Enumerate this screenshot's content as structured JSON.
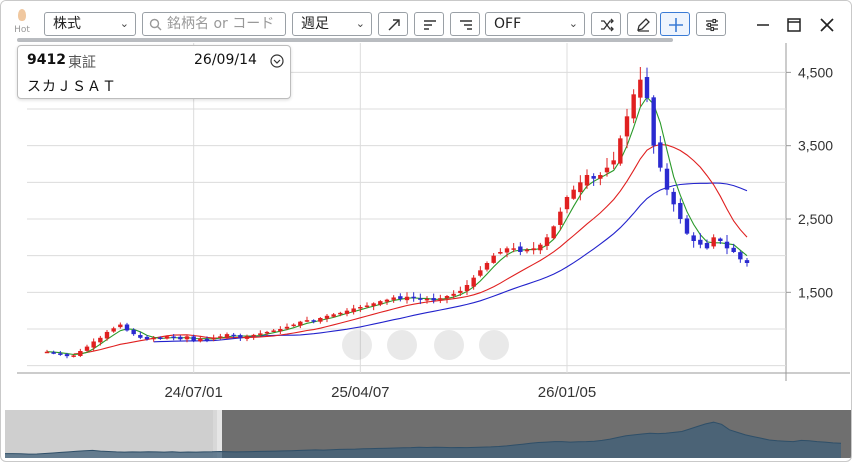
{
  "toolbar": {
    "hot_label": "Hot",
    "market_select": "株式",
    "search_placeholder": "銘柄名 or コード",
    "period_select": "週足",
    "indicator_select": "OFF",
    "icons": [
      "trend-line-icon",
      "align-left-icon",
      "align-right-icon",
      "shuffle-icon",
      "pencil-icon",
      "crosshair-plus-icon",
      "settings-sliders-icon"
    ],
    "window_icons": [
      "minimize-icon",
      "maximize-icon",
      "close-icon"
    ]
  },
  "info_box": {
    "code": "9412",
    "exchange": "東証",
    "date": "26/09/14",
    "name": "スカＪＳＡＴ"
  },
  "chart_data": {
    "type": "candlestick",
    "y_axis": {
      "ticks": [
        "4,500",
        "3,500",
        "2,500",
        "1,500"
      ],
      "range": [
        400,
        4900
      ]
    },
    "x_axis": {
      "ticks": [
        "24/07/01",
        "25/04/07",
        "26/01/05"
      ]
    },
    "close_series": [
      690,
      680,
      660,
      630,
      640,
      700,
      760,
      830,
      880,
      960,
      1010,
      1060,
      980,
      930,
      880,
      860,
      880,
      870,
      900,
      880,
      860,
      900,
      840,
      870,
      860,
      880,
      900,
      930,
      910,
      880,
      900,
      920,
      940,
      960,
      980,
      1000,
      1030,
      1060,
      1100,
      1120,
      1100,
      1150,
      1180,
      1200,
      1220,
      1250,
      1280,
      1300,
      1320,
      1350,
      1380,
      1400,
      1430,
      1410,
      1440,
      1420,
      1400,
      1410,
      1390,
      1420,
      1450,
      1480,
      1520,
      1600,
      1700,
      1800,
      1900,
      2000,
      2050,
      2100,
      2100,
      2050,
      2080,
      2100,
      2150,
      2250,
      2400,
      2600,
      2800,
      2900,
      3000,
      3100,
      3050,
      3100,
      3200,
      3300,
      3600,
      3900,
      4200,
      4400,
      4150,
      3500,
      3200,
      2900,
      2700,
      2500,
      2300,
      2200,
      2150,
      2100,
      2250,
      2200,
      2100,
      2050,
      1950,
      1900
    ],
    "ma_short_color": "#2a9a2a",
    "ma_mid_color": "#e02020",
    "ma_long_color": "#2222cc",
    "up_color": "#e02020",
    "down_color": "#2a2ad0",
    "ghost_controls": [
      "minus",
      "plus",
      "chevron-left",
      "chevron-right"
    ]
  }
}
